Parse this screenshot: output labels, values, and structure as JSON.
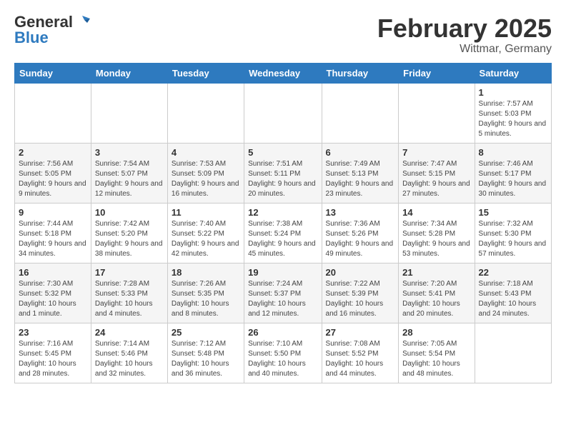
{
  "logo": {
    "general": "General",
    "blue": "Blue"
  },
  "title": "February 2025",
  "location": "Wittmar, Germany",
  "days_of_week": [
    "Sunday",
    "Monday",
    "Tuesday",
    "Wednesday",
    "Thursday",
    "Friday",
    "Saturday"
  ],
  "weeks": [
    [
      {
        "day": "",
        "info": ""
      },
      {
        "day": "",
        "info": ""
      },
      {
        "day": "",
        "info": ""
      },
      {
        "day": "",
        "info": ""
      },
      {
        "day": "",
        "info": ""
      },
      {
        "day": "",
        "info": ""
      },
      {
        "day": "1",
        "info": "Sunrise: 7:57 AM\nSunset: 5:03 PM\nDaylight: 9 hours and 5 minutes."
      }
    ],
    [
      {
        "day": "2",
        "info": "Sunrise: 7:56 AM\nSunset: 5:05 PM\nDaylight: 9 hours and 9 minutes."
      },
      {
        "day": "3",
        "info": "Sunrise: 7:54 AM\nSunset: 5:07 PM\nDaylight: 9 hours and 12 minutes."
      },
      {
        "day": "4",
        "info": "Sunrise: 7:53 AM\nSunset: 5:09 PM\nDaylight: 9 hours and 16 minutes."
      },
      {
        "day": "5",
        "info": "Sunrise: 7:51 AM\nSunset: 5:11 PM\nDaylight: 9 hours and 20 minutes."
      },
      {
        "day": "6",
        "info": "Sunrise: 7:49 AM\nSunset: 5:13 PM\nDaylight: 9 hours and 23 minutes."
      },
      {
        "day": "7",
        "info": "Sunrise: 7:47 AM\nSunset: 5:15 PM\nDaylight: 9 hours and 27 minutes."
      },
      {
        "day": "8",
        "info": "Sunrise: 7:46 AM\nSunset: 5:17 PM\nDaylight: 9 hours and 30 minutes."
      }
    ],
    [
      {
        "day": "9",
        "info": "Sunrise: 7:44 AM\nSunset: 5:18 PM\nDaylight: 9 hours and 34 minutes."
      },
      {
        "day": "10",
        "info": "Sunrise: 7:42 AM\nSunset: 5:20 PM\nDaylight: 9 hours and 38 minutes."
      },
      {
        "day": "11",
        "info": "Sunrise: 7:40 AM\nSunset: 5:22 PM\nDaylight: 9 hours and 42 minutes."
      },
      {
        "day": "12",
        "info": "Sunrise: 7:38 AM\nSunset: 5:24 PM\nDaylight: 9 hours and 45 minutes."
      },
      {
        "day": "13",
        "info": "Sunrise: 7:36 AM\nSunset: 5:26 PM\nDaylight: 9 hours and 49 minutes."
      },
      {
        "day": "14",
        "info": "Sunrise: 7:34 AM\nSunset: 5:28 PM\nDaylight: 9 hours and 53 minutes."
      },
      {
        "day": "15",
        "info": "Sunrise: 7:32 AM\nSunset: 5:30 PM\nDaylight: 9 hours and 57 minutes."
      }
    ],
    [
      {
        "day": "16",
        "info": "Sunrise: 7:30 AM\nSunset: 5:32 PM\nDaylight: 10 hours and 1 minute."
      },
      {
        "day": "17",
        "info": "Sunrise: 7:28 AM\nSunset: 5:33 PM\nDaylight: 10 hours and 4 minutes."
      },
      {
        "day": "18",
        "info": "Sunrise: 7:26 AM\nSunset: 5:35 PM\nDaylight: 10 hours and 8 minutes."
      },
      {
        "day": "19",
        "info": "Sunrise: 7:24 AM\nSunset: 5:37 PM\nDaylight: 10 hours and 12 minutes."
      },
      {
        "day": "20",
        "info": "Sunrise: 7:22 AM\nSunset: 5:39 PM\nDaylight: 10 hours and 16 minutes."
      },
      {
        "day": "21",
        "info": "Sunrise: 7:20 AM\nSunset: 5:41 PM\nDaylight: 10 hours and 20 minutes."
      },
      {
        "day": "22",
        "info": "Sunrise: 7:18 AM\nSunset: 5:43 PM\nDaylight: 10 hours and 24 minutes."
      }
    ],
    [
      {
        "day": "23",
        "info": "Sunrise: 7:16 AM\nSunset: 5:45 PM\nDaylight: 10 hours and 28 minutes."
      },
      {
        "day": "24",
        "info": "Sunrise: 7:14 AM\nSunset: 5:46 PM\nDaylight: 10 hours and 32 minutes."
      },
      {
        "day": "25",
        "info": "Sunrise: 7:12 AM\nSunset: 5:48 PM\nDaylight: 10 hours and 36 minutes."
      },
      {
        "day": "26",
        "info": "Sunrise: 7:10 AM\nSunset: 5:50 PM\nDaylight: 10 hours and 40 minutes."
      },
      {
        "day": "27",
        "info": "Sunrise: 7:08 AM\nSunset: 5:52 PM\nDaylight: 10 hours and 44 minutes."
      },
      {
        "day": "28",
        "info": "Sunrise: 7:05 AM\nSunset: 5:54 PM\nDaylight: 10 hours and 48 minutes."
      },
      {
        "day": "",
        "info": ""
      }
    ]
  ]
}
